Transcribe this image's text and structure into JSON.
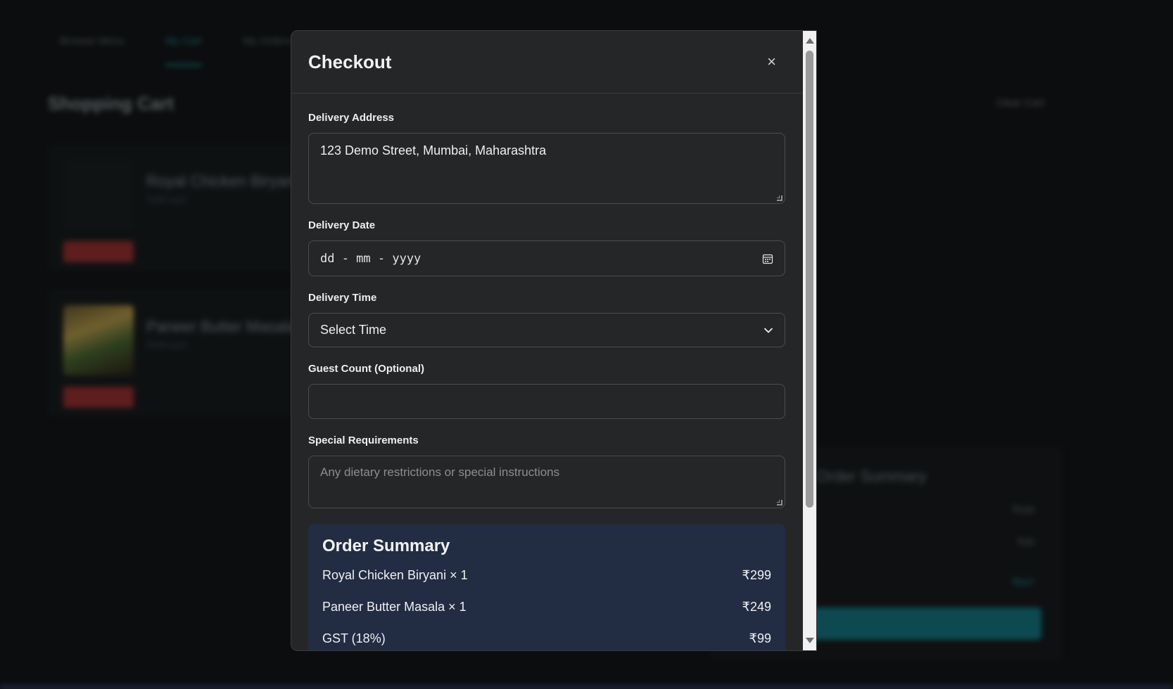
{
  "background": {
    "tabs": [
      "Browse Menu",
      "My Cart",
      "My Orders"
    ],
    "active_tab": "My Cart",
    "page_title": "Shopping Cart",
    "clear_cart": "Clear Cart",
    "cart_items": [
      {
        "name": "Royal Chicken Biryani",
        "sub": "₹299 each",
        "remove": "Remove"
      },
      {
        "name": "Paneer Butter Masala",
        "sub": "₹249 each",
        "remove": "Remove"
      }
    ],
    "summary_title": "Order Summary",
    "summary_values": [
      "₹548",
      "₹99",
      "₹647"
    ],
    "proceed_button": "Proceed to Checkout"
  },
  "modal": {
    "title": "Checkout",
    "close_label": "×",
    "address": {
      "label": "Delivery Address",
      "value": "123 Demo Street, Mumbai, Maharashtra"
    },
    "date": {
      "label": "Delivery Date",
      "placeholder": "dd - mm - yyyy"
    },
    "time": {
      "label": "Delivery Time",
      "selected": "Select Time"
    },
    "guests": {
      "label": "Guest Count (Optional)",
      "value": ""
    },
    "special": {
      "label": "Special Requirements",
      "placeholder": "Any dietary restrictions or special instructions"
    },
    "order_summary": {
      "title": "Order Summary",
      "rows": [
        {
          "label": "Royal Chicken Biryani × 1",
          "amount": "₹299"
        },
        {
          "label": "Paneer Butter Masala × 1",
          "amount": "₹249"
        },
        {
          "label": "GST (18%)",
          "amount": "₹99"
        }
      ]
    }
  },
  "icons": {
    "calendar": "calendar-icon",
    "chevron": "chevron-down-icon",
    "close": "close-icon"
  },
  "colors": {
    "accent": "#1f8f99",
    "summary_bg": "#222d44",
    "modal_bg": "#252627",
    "danger": "#a32c2c"
  }
}
